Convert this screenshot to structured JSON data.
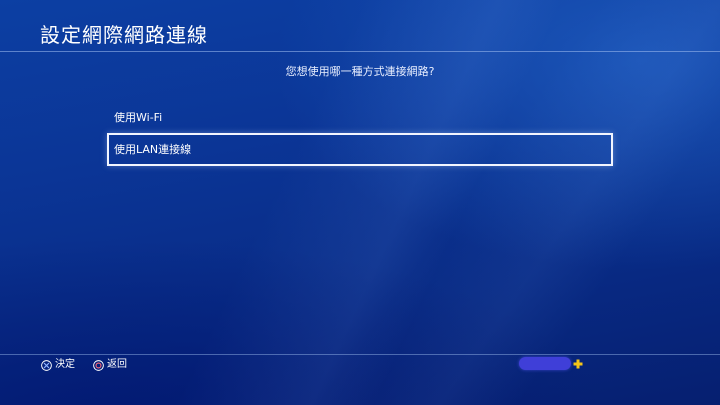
{
  "header": {
    "title": "設定網際網路連線"
  },
  "prompt": {
    "question": "您想使用哪一種方式連接網路?"
  },
  "options": [
    {
      "label": "使用Wi-Fi",
      "selected": false
    },
    {
      "label": "使用LAN連接線",
      "selected": true
    }
  ],
  "footer": {
    "confirm_label": "決定",
    "back_label": "返回",
    "confirm_icon": "cross-button-icon",
    "back_icon": "circle-button-icon",
    "plus_icon": "playstation-plus-icon"
  },
  "colors": {
    "background": "#0b3596",
    "text": "#ffffff",
    "selection_border": "#f2f5ff",
    "plus_icon": "#f5c518",
    "user_blob": "#3f3fd8"
  }
}
